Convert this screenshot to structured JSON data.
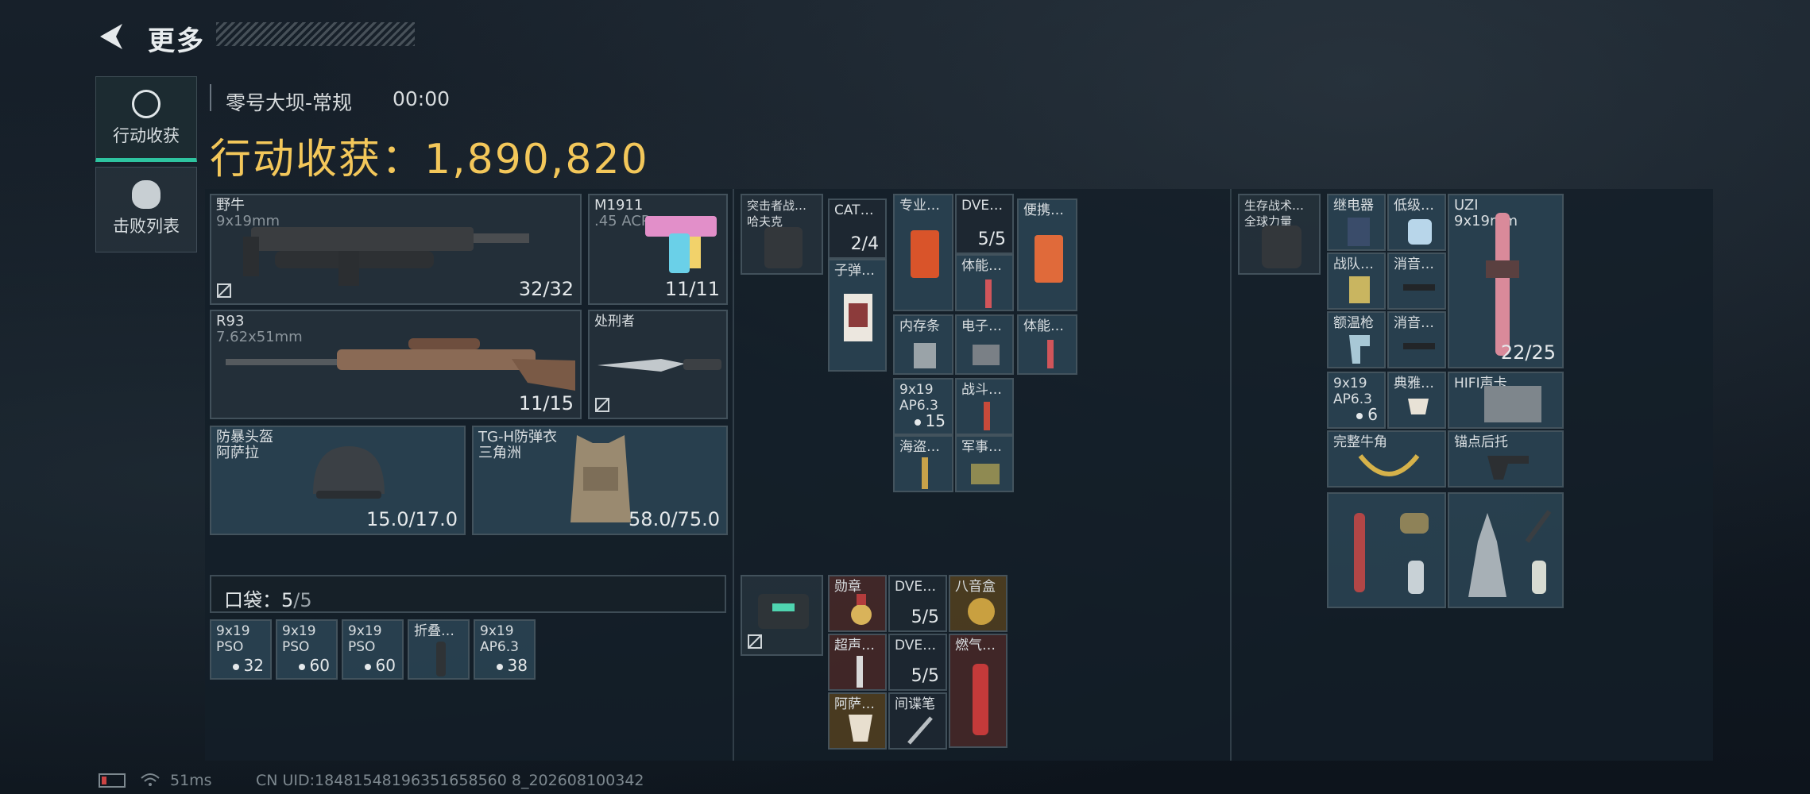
{
  "header": {
    "title": "更多"
  },
  "tabs": [
    {
      "label": "行动收获",
      "active": true
    },
    {
      "label": "击败列表",
      "active": false
    }
  ],
  "raid": {
    "map": "零号大坝-常规",
    "time": "00:00",
    "total_label": "行动收获：",
    "total_value": "1,890,820"
  },
  "equipment": {
    "primary": {
      "name": "野牛",
      "ammo": "9x19mm",
      "count": "32/32"
    },
    "pistol": {
      "name": "M1911",
      "ammo": ".45 ACP",
      "count": "11/11"
    },
    "rifle": {
      "name": "R93",
      "ammo": "7.62x51mm",
      "count": "11/15"
    },
    "melee": {
      "name": "处刑者"
    },
    "helmet": {
      "name": "防暴头盔",
      "sub": "阿萨拉",
      "durability": "15.0/17.0"
    },
    "armor": {
      "name": "TG-H防弹衣",
      "sub": "三角洲",
      "durability": "58.0/75.0"
    }
  },
  "pocket": {
    "label": "口袋：",
    "used": "5",
    "capacity": "/5",
    "items": [
      {
        "name": "9x19",
        "sub": "PSO",
        "count": "32"
      },
      {
        "name": "9x19",
        "sub": "PSO",
        "count": "60"
      },
      {
        "name": "9x19",
        "sub": "PSO",
        "count": "60"
      },
      {
        "name": "折叠…",
        "sub": "",
        "count": ""
      },
      {
        "name": "9x19",
        "sub": "AP6.3",
        "count": "38"
      }
    ]
  },
  "rig": {
    "name": "突击者战…",
    "sub": "哈夫克",
    "items": {
      "cat": {
        "name": "CAT…",
        "count": "2/4"
      },
      "ammo_box": {
        "name": "子弹…"
      },
      "pro": {
        "name": "专业…"
      },
      "dve1": {
        "name": "DVE…",
        "count": "5/5"
      },
      "stam1": {
        "name": "体能…"
      },
      "portable": {
        "name": "便携…"
      },
      "mem": {
        "name": "内存条"
      },
      "elec": {
        "name": "电子…"
      },
      "stam2": {
        "name": "体能…"
      },
      "ap": {
        "name": "9x19",
        "sub": "AP6.3",
        "count": "15"
      },
      "combat": {
        "name": "战斗…"
      },
      "pirate": {
        "name": "海盗…"
      },
      "military": {
        "name": "军事…"
      }
    }
  },
  "safe_box": {
    "items": {
      "medal": {
        "name": "勋章"
      },
      "dve2": {
        "name": "DVE…",
        "count": "5/5"
      },
      "octa": {
        "name": "八音盒"
      },
      "super": {
        "name": "超声…"
      },
      "dve3": {
        "name": "DVE…",
        "count": "5/5"
      },
      "gas": {
        "name": "燃气…"
      },
      "cup": {
        "name": "阿萨…"
      },
      "spy": {
        "name": "间谍笔"
      }
    }
  },
  "backpack": {
    "name": "生存战术…",
    "sub": "全球力量",
    "items": {
      "relay": {
        "name": "继电器"
      },
      "low": {
        "name": "低级…"
      },
      "team": {
        "name": "战队…"
      },
      "silencer1": {
        "name": "消音…"
      },
      "thermo": {
        "name": "额温枪"
      },
      "silencer2": {
        "name": "消音…"
      },
      "uzi": {
        "name": "UZI",
        "ammo": "9x19mm",
        "count": "22/25"
      },
      "ap2": {
        "name": "9x19",
        "sub": "AP6.3",
        "count": "6"
      },
      "tea": {
        "name": "典雅…"
      },
      "hifi": {
        "name": "HIFI声卡"
      },
      "horn": {
        "name": "完整牛角"
      },
      "anchor": {
        "name": "锚点后托"
      }
    }
  },
  "status_bar": {
    "ping": "51ms",
    "uid": "CN UID:18481548196351658560 8_202608100342"
  },
  "colors": {
    "accent": "#2ec4a0",
    "gold": "#f3c75a"
  }
}
